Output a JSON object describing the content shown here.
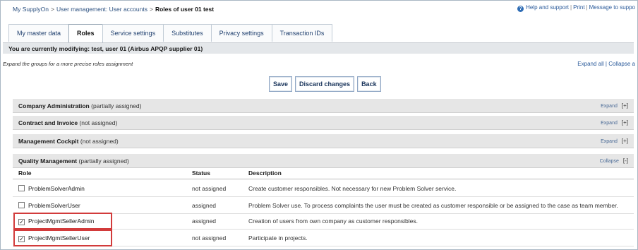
{
  "breadcrumb": {
    "items": [
      "My SupplyOn",
      "User management: User accounts",
      "Roles of user 01 test"
    ],
    "separator": ">"
  },
  "help": {
    "links": [
      "Help and support",
      "Print",
      "Message to suppo"
    ],
    "separator": "|"
  },
  "tabs": [
    {
      "label": "My master data",
      "active": false
    },
    {
      "label": "Roles",
      "active": true
    },
    {
      "label": "Service settings",
      "active": false
    },
    {
      "label": "Substitutes",
      "active": false
    },
    {
      "label": "Privacy settings",
      "active": false
    },
    {
      "label": "Transaction IDs",
      "active": false
    }
  ],
  "modifying_text": "You are currently modifying: test, user 01 (Airbus APQP supplier 01)",
  "hint_text": "Expand the groups for a more precise roles assignment",
  "expand_all": {
    "expand": "Expand all",
    "separator": "|",
    "collapse": "Collapse a"
  },
  "buttons": {
    "save": "Save",
    "discard": "Discard changes",
    "back": "Back"
  },
  "groups": [
    {
      "name": "Company Administration",
      "status": "(partially assigned)",
      "action": "Expand",
      "toggle": "[+]"
    },
    {
      "name": "Contract and Invoice",
      "status": "(not assigned)",
      "action": "Expand",
      "toggle": "[+]"
    },
    {
      "name": "Management Cockpit",
      "status": "(not assigned)",
      "action": "Expand",
      "toggle": "[+]"
    },
    {
      "name": "Quality Management",
      "status": "(partially assigned)",
      "action": "Collapse",
      "toggle": "[-]"
    }
  ],
  "table": {
    "headers": {
      "role": "Role",
      "status": "Status",
      "description": "Description"
    },
    "rows": [
      {
        "role": "ProblemSolverAdmin",
        "checked": false,
        "check_mark": "",
        "status": "not assigned",
        "description": "Create customer responsibles. Not necessary for new Problem Solver service."
      },
      {
        "role": "ProblemSolverUser",
        "checked": false,
        "check_mark": "",
        "status": "assigned",
        "description": "Problem Solver use. To process complaints the user must be created as customer responsible or be assigned to the case as team member."
      },
      {
        "role": "ProjectMgmtSellerAdmin",
        "checked": true,
        "check_mark": "✓",
        "status": "assigned",
        "description": "Creation of users from own company as customer responsibles."
      },
      {
        "role": "ProjectMgmtSellerUser",
        "checked": true,
        "check_mark": "✓",
        "status": "not assigned",
        "description": "Participate in projects."
      }
    ]
  },
  "colors": {
    "highlight": "#d23b3b",
    "link": "#2a5a9a",
    "group_bg": "#e6e6e6"
  },
  "icons": {
    "help": "question-circle-icon",
    "checkbox": "checkbox-icon"
  }
}
